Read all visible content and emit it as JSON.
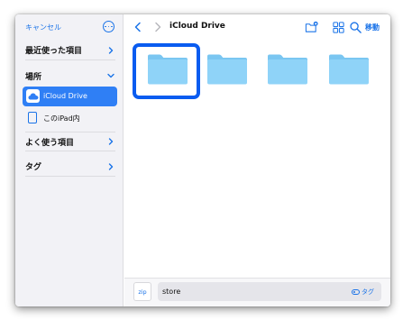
{
  "sidebar": {
    "cancel_label": "キャンセル",
    "sections": {
      "recents": "最近使った項目",
      "locations": "場所",
      "favorites": "よく使う項目",
      "tags": "タグ"
    },
    "items": [
      {
        "label": "iCloud Drive",
        "icon": "icloud-icon",
        "selected": true
      },
      {
        "label": "このiPad内",
        "icon": "ipad-icon",
        "selected": false
      }
    ]
  },
  "toolbar": {
    "title": "iCloud Drive",
    "move_label": "移動"
  },
  "folders": [
    {
      "icon": "folder-icon",
      "selected": true
    },
    {
      "icon": "folder-icon",
      "selected": false
    },
    {
      "icon": "folder-icon",
      "selected": false
    },
    {
      "icon": "folder-icon",
      "selected": false
    }
  ],
  "bottom_bar": {
    "zip_label": "zip",
    "filename_value": "store",
    "tag_label": "タグ"
  },
  "colors": {
    "accent": "#1a73e8",
    "selected_row": "#2f7ff5",
    "folder": "#8fd3f8",
    "selection_outline": "#0a5cf0"
  }
}
